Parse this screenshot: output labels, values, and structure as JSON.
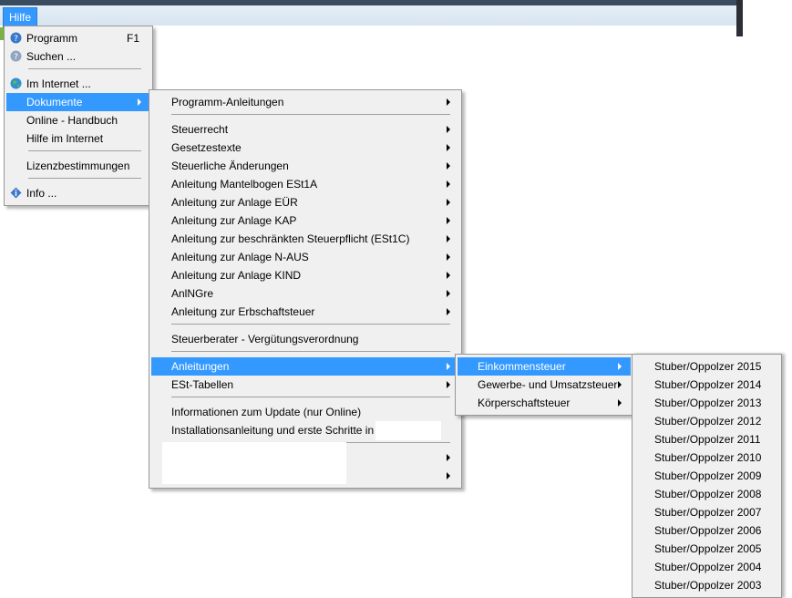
{
  "menubar": {
    "help_label": "Hilfe"
  },
  "help_menu": {
    "items": [
      {
        "label": "Programm",
        "shortcut": "F1",
        "icon": "help-circle-icon"
      },
      {
        "label": "Suchen ...",
        "icon": "search-help-icon"
      },
      {
        "label": "Im Internet ...",
        "icon": "globe-icon"
      },
      {
        "label": "Dokumente"
      },
      {
        "label": "Online - Handbuch"
      },
      {
        "label": "Hilfe im Internet"
      },
      {
        "label": "Lizenzbestimmungen"
      },
      {
        "label": "Info ...",
        "icon": "info-icon"
      }
    ]
  },
  "documents_menu": {
    "items": [
      {
        "label": "Programm-Anleitungen"
      },
      {
        "label": "Steuerrecht"
      },
      {
        "label": "Gesetzestexte"
      },
      {
        "label": "Steuerliche Änderungen"
      },
      {
        "label": "Anleitung Mantelbogen ESt1A"
      },
      {
        "label": "Anleitung zur Anlage EÜR"
      },
      {
        "label": "Anleitung zur Anlage KAP"
      },
      {
        "label": "Anleitung zur beschränkten Steuerpflicht (ESt1C)"
      },
      {
        "label": "Anleitung zur Anlage N-AUS"
      },
      {
        "label": "Anleitung zur Anlage KIND"
      },
      {
        "label": "AnlNGre"
      },
      {
        "label": "Anleitung zur Erbschaftsteuer"
      },
      {
        "label": "Steuerberater - Vergütungsverordnung"
      },
      {
        "label": "Anleitungen"
      },
      {
        "label": "ESt-Tabellen"
      },
      {
        "label": "Informationen zum Update (nur Online)"
      },
      {
        "label": "Installationsanleitung und erste Schritte in"
      }
    ]
  },
  "guides_menu": {
    "items": [
      {
        "label": "Einkommensteuer"
      },
      {
        "label": "Gewerbe- und Umsatzsteuer"
      },
      {
        "label": "Körperschaftsteuer"
      }
    ]
  },
  "income_tax_menu": {
    "items": [
      {
        "label": "Stuber/Oppolzer 2015"
      },
      {
        "label": "Stuber/Oppolzer 2014"
      },
      {
        "label": "Stuber/Oppolzer 2013"
      },
      {
        "label": "Stuber/Oppolzer 2012"
      },
      {
        "label": "Stuber/Oppolzer 2011"
      },
      {
        "label": "Stuber/Oppolzer 2010"
      },
      {
        "label": "Stuber/Oppolzer 2009"
      },
      {
        "label": "Stuber/Oppolzer 2008"
      },
      {
        "label": "Stuber/Oppolzer 2007"
      },
      {
        "label": "Stuber/Oppolzer 2006"
      },
      {
        "label": "Stuber/Oppolzer 2005"
      },
      {
        "label": "Stuber/Oppolzer 2004"
      },
      {
        "label": "Stuber/Oppolzer 2003"
      }
    ]
  },
  "colors": {
    "highlight": "#3399ff",
    "menu_bg": "#f0f0f0"
  }
}
